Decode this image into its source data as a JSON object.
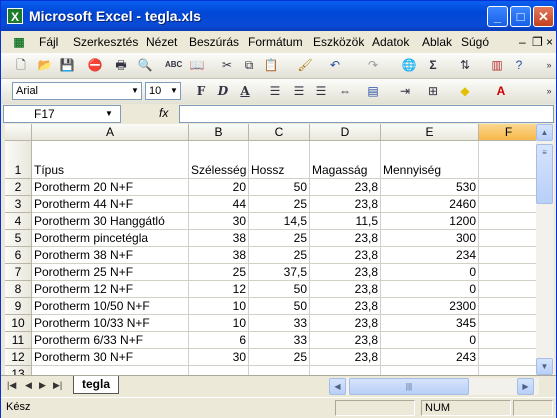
{
  "window": {
    "title": "Microsoft Excel - tegla.xls",
    "app_icon": "X"
  },
  "menubar": {
    "items": [
      "Fájl",
      "Szerkesztés",
      "Nézet",
      "Beszúrás",
      "Formátum",
      "Eszközök",
      "Adatok",
      "Ablak",
      "Súgó"
    ]
  },
  "formatting": {
    "font": "Arial",
    "size": "10"
  },
  "formula_bar": {
    "namebox": "F17",
    "fx_label": "fx",
    "content": ""
  },
  "sheet": {
    "columns": [
      "A",
      "B",
      "C",
      "D",
      "E",
      "F"
    ],
    "selected_column": "F",
    "rows": [
      {
        "n": "1",
        "a": "Típus",
        "b": "Szélesség",
        "c": "Hossz",
        "d": "Magasság",
        "e": "Mennyiség"
      },
      {
        "n": "2",
        "a": "Porotherm 20 N+F",
        "b": "20",
        "c": "50",
        "d": "23,8",
        "e": "530"
      },
      {
        "n": "3",
        "a": "Porotherm 44 N+F",
        "b": "44",
        "c": "25",
        "d": "23,8",
        "e": "2460"
      },
      {
        "n": "4",
        "a": "Porotherm 30 Hanggátló",
        "b": "30",
        "c": "14,5",
        "d": "11,5",
        "e": "1200"
      },
      {
        "n": "5",
        "a": "Porotherm pincetégla",
        "b": "38",
        "c": "25",
        "d": "23,8",
        "e": "300"
      },
      {
        "n": "6",
        "a": "Porotherm 38 N+F",
        "b": "38",
        "c": "25",
        "d": "23,8",
        "e": "234"
      },
      {
        "n": "7",
        "a": "Porotherm 25 N+F",
        "b": "25",
        "c": "37,5",
        "d": "23,8",
        "e": "0"
      },
      {
        "n": "8",
        "a": "Porotherm 12 N+F",
        "b": "12",
        "c": "50",
        "d": "23,8",
        "e": "0"
      },
      {
        "n": "9",
        "a": "Porotherm 10/50 N+F",
        "b": "10",
        "c": "50",
        "d": "23,8",
        "e": "2300"
      },
      {
        "n": "10",
        "a": "Porotherm 10/33 N+F",
        "b": "10",
        "c": "33",
        "d": "23,8",
        "e": "345"
      },
      {
        "n": "11",
        "a": "Porotherm 6/33 N+F",
        "b": "6",
        "c": "33",
        "d": "23,8",
        "e": "0"
      },
      {
        "n": "12",
        "a": "Porotherm 30 N+F",
        "b": "30",
        "c": "25",
        "d": "23,8",
        "e": "243"
      },
      {
        "n": "13",
        "a": "",
        "b": "",
        "c": "",
        "d": "",
        "e": ""
      }
    ],
    "tab": "tegla"
  },
  "status": {
    "left": "Kész",
    "num": "NUM"
  },
  "colors": {
    "selected_header": "#f7b84a",
    "titlebar": "#0147d6"
  }
}
